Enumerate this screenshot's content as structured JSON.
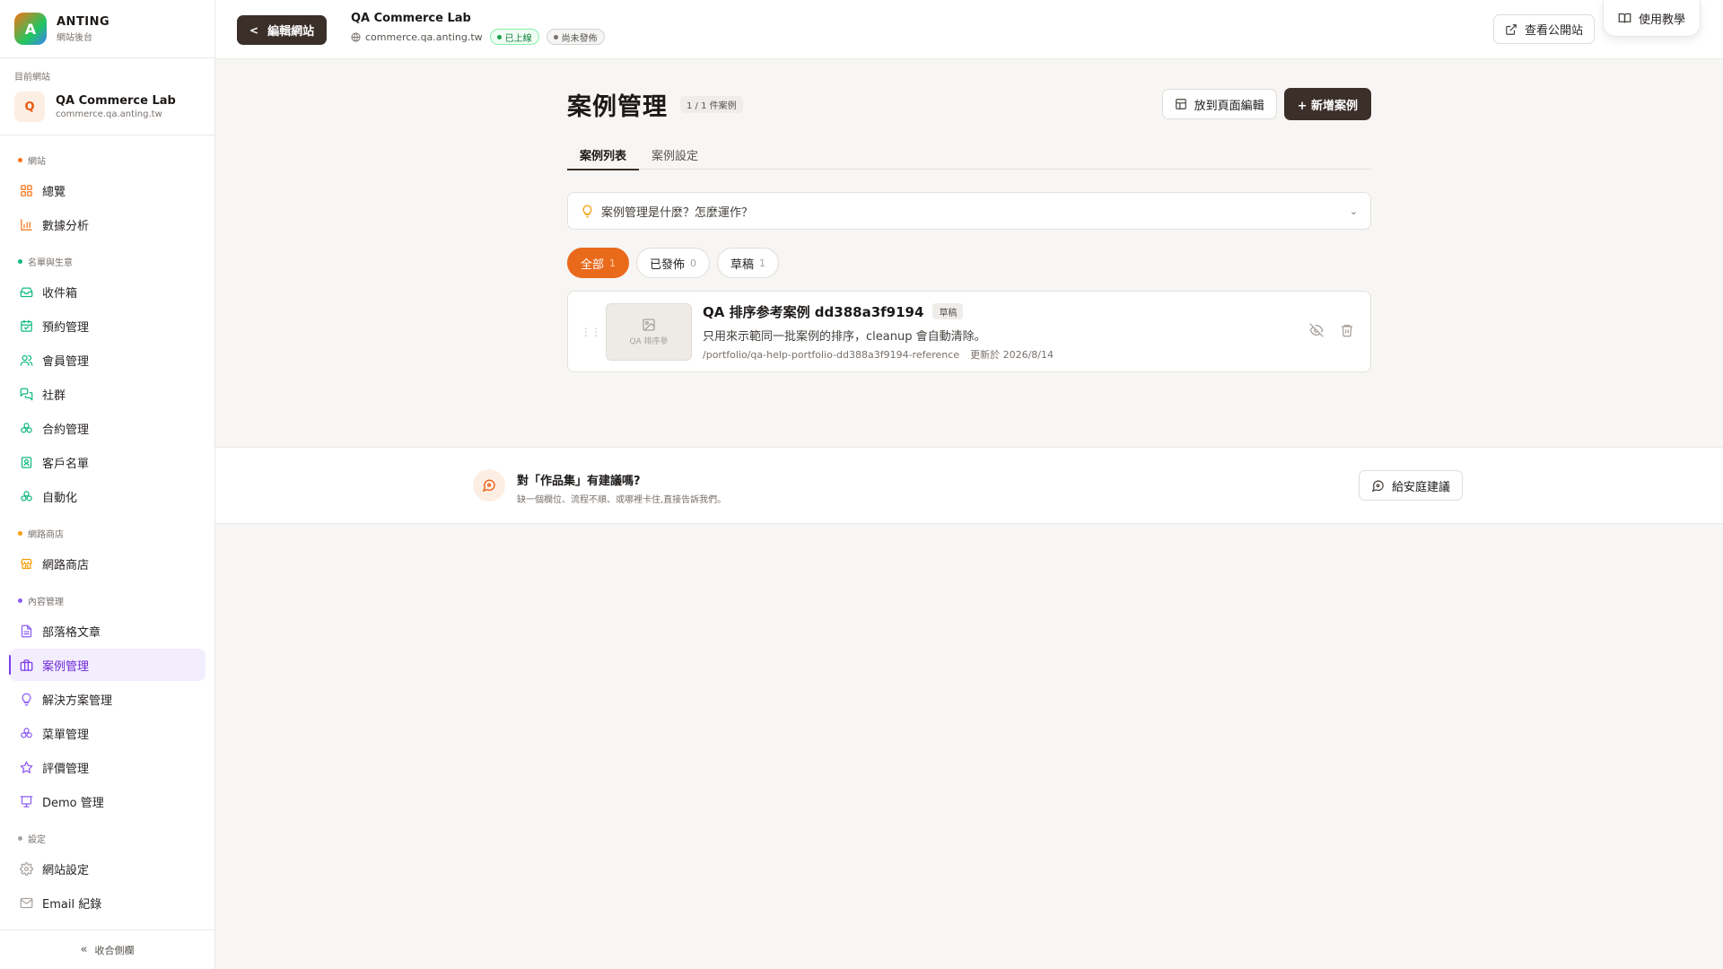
{
  "brand": {
    "logo_letter": "A",
    "name": "ANTING",
    "subtitle": "網站後台"
  },
  "current_site": {
    "label": "目前網站",
    "avatar_letter": "Q",
    "name": "QA Commerce Lab",
    "domain": "commerce.qa.anting.tw"
  },
  "sidebar": {
    "sections": [
      {
        "label": "網站",
        "color": "#f97316",
        "items": [
          {
            "label": "總覽",
            "icon": "grid-icon"
          },
          {
            "label": "數據分析",
            "icon": "bar-chart-icon"
          }
        ]
      },
      {
        "label": "名單與生意",
        "color": "#10b981",
        "items": [
          {
            "label": "收件箱",
            "icon": "inbox-icon"
          },
          {
            "label": "預約管理",
            "icon": "calendar-icon"
          },
          {
            "label": "會員管理",
            "icon": "users-icon"
          },
          {
            "label": "社群",
            "icon": "chat-icon"
          },
          {
            "label": "合約管理",
            "icon": "cluster-icon"
          },
          {
            "label": "客戶名單",
            "icon": "contact-icon"
          },
          {
            "label": "自動化",
            "icon": "cluster-icon"
          }
        ]
      },
      {
        "label": "網路商店",
        "color": "#f59e0b",
        "items": [
          {
            "label": "網路商店",
            "icon": "store-icon"
          }
        ]
      },
      {
        "label": "內容管理",
        "color": "#8b5cf6",
        "items": [
          {
            "label": "部落格文章",
            "icon": "document-icon"
          },
          {
            "label": "案例管理",
            "icon": "briefcase-icon",
            "active": true
          },
          {
            "label": "解決方案管理",
            "icon": "lightbulb-icon"
          },
          {
            "label": "菜單管理",
            "icon": "cluster-icon"
          },
          {
            "label": "評價管理",
            "icon": "star-icon"
          },
          {
            "label": "Demo 管理",
            "icon": "presentation-icon"
          }
        ]
      },
      {
        "label": "設定",
        "color": "#a8a29e",
        "items": [
          {
            "label": "網站設定",
            "icon": "gear-icon"
          },
          {
            "label": "Email 紀錄",
            "icon": "mail-icon"
          }
        ]
      }
    ],
    "collapse_label": "收合側欄"
  },
  "topbar": {
    "back_label": "編輯網站",
    "site_name": "QA Commerce Lab",
    "site_domain": "commerce.qa.anting.tw",
    "status_live": "已上線",
    "status_unpublished": "尚未發佈",
    "view_site_label": "查看公開站",
    "tutorial_label": "使用教學"
  },
  "page": {
    "title": "案例管理",
    "count": "1 / 1 件案例",
    "layout_button": "放到頁面編輯",
    "new_button": "+ 新增案例",
    "tabs": [
      {
        "label": "案例列表",
        "active": true
      },
      {
        "label": "案例設定",
        "active": false
      }
    ],
    "faq_text": "案例管理是什麼？怎麼運作？",
    "filters": [
      {
        "label": "全部",
        "count": "1",
        "active": true
      },
      {
        "label": "已發佈",
        "count": "0",
        "active": false
      },
      {
        "label": "草稿",
        "count": "1",
        "active": false
      }
    ],
    "items": [
      {
        "thumb_text": "QA 排序參",
        "title": "QA 排序参考案例 dd388a3f9194",
        "status": "草稿",
        "description": "只用來示範同一批案例的排序，cleanup 會自動清除。",
        "path": "/portfolio/qa-help-portfolio-dd388a3f9194-reference",
        "updated": "更新於 2026/8/14"
      }
    ]
  },
  "feedback": {
    "title": "對「作品集」有建議嗎?",
    "subtitle": "缺一個欄位、流程不順、或哪裡卡住,直接告訴我們。",
    "button": "給安庭建議"
  },
  "colors": {
    "accent": "#ea6a1c",
    "dark": "#3b2f2a",
    "active_nav": "#6d28d9"
  }
}
